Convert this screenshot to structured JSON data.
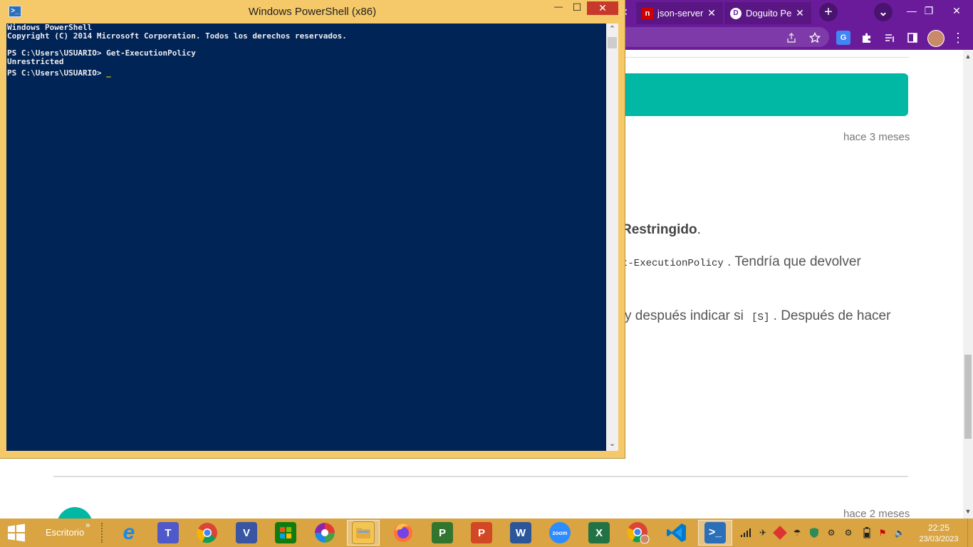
{
  "chrome": {
    "tabs": [
      {
        "label": "json-server",
        "close": "✕",
        "favicon_color": "#cc0000",
        "favicon_text": "n"
      },
      {
        "label": "Doguito Pe",
        "close": "✕",
        "favicon_color": "#ffffff",
        "favicon_text": "D"
      }
    ],
    "partial_tab_close": "✕",
    "new_tab": "+",
    "tab_search": "⌄",
    "window_controls": {
      "minimize": "—",
      "maximize": "❐",
      "close": "✕"
    },
    "toolbar_icons": [
      "share-icon",
      "bookmark-star-icon",
      "translate-icon",
      "extensions-icon",
      "reading-list-icon",
      "side-panel-icon",
      "profile-avatar-icon",
      "menu-icon"
    ]
  },
  "page": {
    "comment1_time": "hace 3 meses",
    "bold_word": "Restringido",
    "bold_tail": ".",
    "line2_code": "t-ExecutionPolicy",
    "line2_text": ". Tendría que devolver",
    "line3_text": "y después indicar si",
    "line3_code": "[S]",
    "line3_tail": ". Después de hacer",
    "comment2_time": "hace 2 meses",
    "accent_color": "#00b8a3"
  },
  "powershell": {
    "title": "Windows PowerShell (x86)",
    "controls": {
      "minimize": "—",
      "maximize": "☐",
      "close": "✕"
    },
    "lines": [
      "Windows PowerShell",
      "Copyright (C) 2014 Microsoft Corporation. Todos los derechos reservados.",
      "",
      "PS C:\\Users\\USUARIO> Get-ExecutionPolicy",
      "Unrestricted",
      "PS C:\\Users\\USUARIO> "
    ],
    "cursor": "_",
    "scroll_up": "⌃",
    "scroll_down": "⌄",
    "bg_color": "#012456"
  },
  "taskbar": {
    "desktop_label": "Escritorio",
    "chevron": "»",
    "apps": [
      {
        "name": "internet-explorer",
        "letter": "e",
        "color": "#1e88e5"
      },
      {
        "name": "teams",
        "letter": "T",
        "color": "#5059c9"
      },
      {
        "name": "chrome",
        "letter": "",
        "color": "#34a853"
      },
      {
        "name": "visio",
        "letter": "V",
        "color": "#3955a3"
      },
      {
        "name": "microsoft-store",
        "letter": "",
        "color": "#107c10"
      },
      {
        "name": "picasa",
        "letter": "",
        "color": "#8e44ad"
      },
      {
        "name": "file-explorer",
        "letter": "",
        "color": "#e8b84a"
      },
      {
        "name": "firefox",
        "letter": "",
        "color": "#ff7139"
      },
      {
        "name": "project",
        "letter": "P",
        "color": "#31752f"
      },
      {
        "name": "powerpoint",
        "letter": "P",
        "color": "#d24726"
      },
      {
        "name": "word",
        "letter": "W",
        "color": "#2b579a"
      },
      {
        "name": "zoom",
        "letter": "zoom",
        "color": "#2d8cff"
      },
      {
        "name": "excel",
        "letter": "X",
        "color": "#217346"
      },
      {
        "name": "chrome-profile",
        "letter": "",
        "color": "#34a853"
      },
      {
        "name": "vscode",
        "letter": "",
        "color": "#007acc"
      },
      {
        "name": "powershell",
        "letter": "",
        "color": "#2a6fb8"
      }
    ],
    "clock_time": "22:25",
    "clock_date": "23/03/2023"
  }
}
